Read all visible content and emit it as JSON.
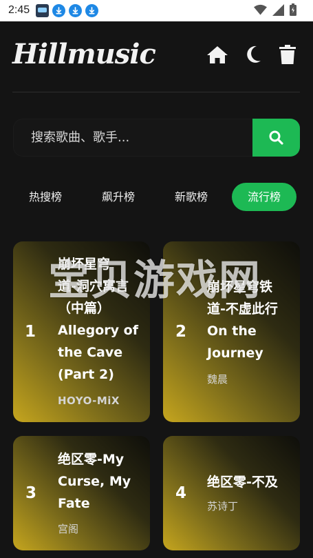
{
  "status": {
    "time": "2:45"
  },
  "app": {
    "logo": "Hillmusic"
  },
  "header_icons": [
    "home-icon",
    "moon-icon",
    "trash-icon"
  ],
  "search": {
    "placeholder": "搜索歌曲、歌手..."
  },
  "tabs": [
    {
      "label": "热搜榜",
      "active": false
    },
    {
      "label": "飙升榜",
      "active": false
    },
    {
      "label": "新歌榜",
      "active": false
    },
    {
      "label": "流行榜",
      "active": true
    }
  ],
  "songs": [
    {
      "rank": "1",
      "title_lines": [
        "崩坏星穹",
        "道-洞穴寓言",
        "（中篇）",
        "Allegory of",
        "the Cave",
        "(Part 2)"
      ],
      "artist": "HOYO-MiX"
    },
    {
      "rank": "2",
      "title_lines": [
        "崩坏星穹铁",
        "道-不虚此行",
        "On the",
        "Journey"
      ],
      "artist": "魏晨"
    },
    {
      "rank": "3",
      "title_lines": [
        "绝区零-My",
        "Curse, My",
        "Fate"
      ],
      "artist": "宫阁"
    },
    {
      "rank": "4",
      "title_lines": [
        "绝区零-不及"
      ],
      "artist": "苏诗丁"
    }
  ],
  "watermark": "宝贝游戏网",
  "colors": {
    "accent": "#1db954",
    "background": "#141414"
  }
}
